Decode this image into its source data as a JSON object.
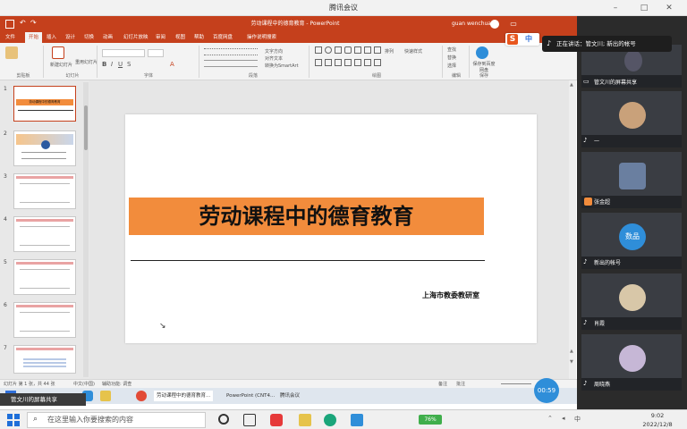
{
  "meeting": {
    "title": "腾讯会议",
    "notice": "正在讲话：管文川; 新出的帐号",
    "speaking": "管文川的屏幕共享",
    "timer": "00:59"
  },
  "ppt": {
    "title": "劳动课程中的德育教育 - PowerPoint",
    "user": "guan wenchuan",
    "tabs": [
      "文件",
      "开始",
      "插入",
      "设计",
      "切换",
      "动画",
      "幻灯片放映",
      "审阅",
      "视图",
      "帮助",
      "百度网盘",
      "操作说明搜索"
    ],
    "ribbon": {
      "groups": [
        "剪贴板",
        "幻灯片",
        "字体",
        "段落",
        "绘图",
        "编辑",
        "保存"
      ],
      "buttons": {
        "new_slide": "新建幻灯片",
        "reuse": "重用幻灯片",
        "find": "查找",
        "replace": "替换",
        "select": "选择",
        "save_baidu": "保存到百度网盘",
        "text_direction": "文字方向",
        "align_text": "对齐文本",
        "smartart": "转换为SmartArt",
        "arrange": "排列",
        "quick_styles": "快速样式"
      }
    },
    "thumbnails": [
      {
        "num": "1",
        "caption": "劳动课程中的德育教育"
      },
      {
        "num": "2",
        "caption": ""
      },
      {
        "num": "3",
        "caption": ""
      },
      {
        "num": "4",
        "caption": ""
      },
      {
        "num": "5",
        "caption": ""
      },
      {
        "num": "6",
        "caption": ""
      },
      {
        "num": "7",
        "caption": ""
      }
    ],
    "slide": {
      "title": "劳动课程中的德育教育",
      "org": "上海市教委教研室"
    },
    "status": {
      "slide_count": "幻灯片 第 1 张，共 44 张",
      "language": "中文(中国)",
      "accessibility": "辅助功能: 调查",
      "notes": "备注",
      "comments": "批注"
    }
  },
  "inner_taskbar": [
    {
      "label": "劳动课程中的德育教育..."
    },
    {
      "label": "PowerPoint (CNT4..."
    },
    {
      "label": "腾讯会议"
    }
  ],
  "participants": [
    {
      "name": "管文川的屏幕共享"
    },
    {
      "name": "一"
    },
    {
      "name": "张金超"
    },
    {
      "name": "新出的帐号"
    },
    {
      "name": "肖霞"
    },
    {
      "name": "周晓燕"
    }
  ],
  "avatar_text": "数品",
  "taskbar": {
    "search_placeholder": "在这里输入你要搜索的内容",
    "battery": "76%",
    "time": "9:02",
    "date": "2022/12/8"
  },
  "colors": {
    "ppt_brand": "#c5401c",
    "slide_banner": "#f28c3c",
    "timer": "#2f8ed9"
  }
}
